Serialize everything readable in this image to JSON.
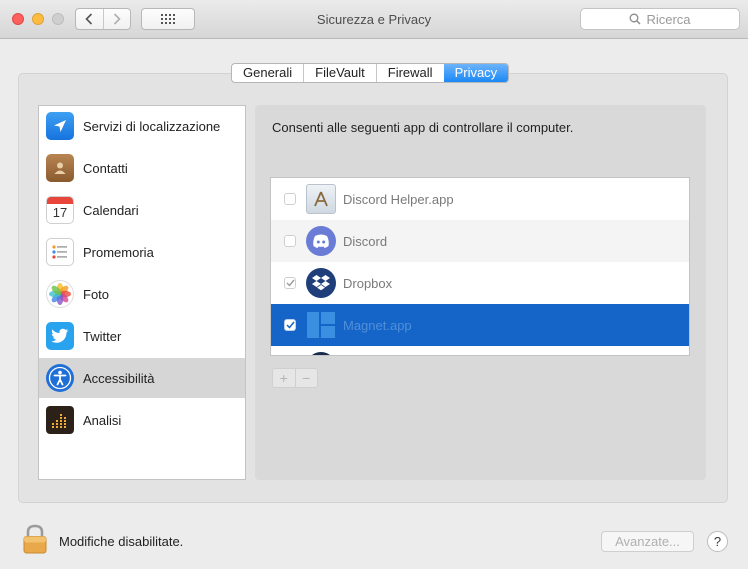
{
  "window": {
    "title": "Sicurezza e Privacy"
  },
  "search": {
    "placeholder": "Ricerca"
  },
  "tabs": [
    {
      "label": "Generali",
      "active": false
    },
    {
      "label": "FileVault",
      "active": false
    },
    {
      "label": "Firewall",
      "active": false
    },
    {
      "label": "Privacy",
      "active": true
    }
  ],
  "sidebar": {
    "items": [
      {
        "label": "Servizi di localizzazione",
        "icon": "location-arrow-icon"
      },
      {
        "label": "Contatti",
        "icon": "contacts-icon"
      },
      {
        "label": "Calendari",
        "icon": "calendar-icon",
        "icon_text": "17"
      },
      {
        "label": "Promemoria",
        "icon": "reminders-icon"
      },
      {
        "label": "Foto",
        "icon": "photos-icon"
      },
      {
        "label": "Twitter",
        "icon": "twitter-icon"
      },
      {
        "label": "Accessibilità",
        "icon": "accessibility-icon",
        "selected": true
      },
      {
        "label": "Analisi",
        "icon": "analytics-icon"
      }
    ]
  },
  "main": {
    "instruction": "Consenti alle seguenti app di controllare il computer.",
    "apps": [
      {
        "name": "Discord Helper.app",
        "checked": false,
        "icon": "app-installer-icon"
      },
      {
        "name": "Discord",
        "checked": false,
        "icon": "discord-icon"
      },
      {
        "name": "Dropbox",
        "checked": true,
        "icon": "dropbox-icon"
      },
      {
        "name": "Magnet.app",
        "checked": true,
        "selected": true,
        "icon": "magnet-icon"
      }
    ],
    "add_label": "+",
    "remove_label": "−"
  },
  "footer": {
    "lock_text": "Modifiche disabilitate.",
    "advanced_label": "Avanzate...",
    "help_label": "?"
  },
  "colors": {
    "accent": "#1b89f5",
    "selection": "#1565c8"
  }
}
